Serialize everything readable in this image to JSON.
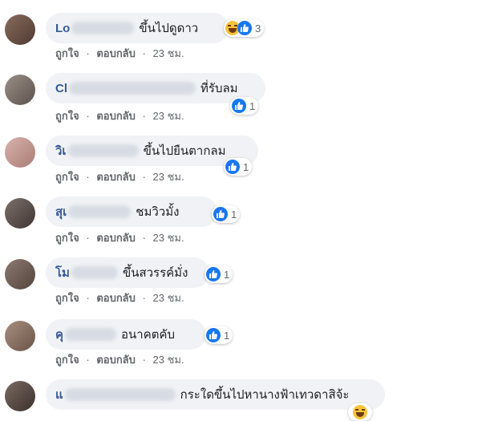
{
  "comments": [
    {
      "name": "Lo",
      "text": "ขึ้นไปดูดาว",
      "reactions": [
        "haha",
        "like"
      ],
      "count": "3",
      "like": "ถูกใจ",
      "reply": "ตอบกลับ",
      "time": "23 ชม."
    },
    {
      "name": "Cl",
      "text": "ที่รับลม",
      "reactions": [
        "like"
      ],
      "count": "1",
      "like": "ถูกใจ",
      "reply": "ตอบกลับ",
      "time": "23 ชม."
    },
    {
      "name": "วิเ",
      "text": "ขึ้นไปยืนตากลม",
      "reactions": [
        "like"
      ],
      "count": "1",
      "like": "ถูกใจ",
      "reply": "ตอบกลับ",
      "time": "23 ชม."
    },
    {
      "name": "สุเ",
      "text": "ชมวิวมั้ง",
      "reactions": [
        "like"
      ],
      "count": "1",
      "like": "ถูกใจ",
      "reply": "ตอบกลับ",
      "time": "23 ชม."
    },
    {
      "name": "โม",
      "text": "ขึ้นสวรรค์มั่ง",
      "reactions": [
        "like"
      ],
      "count": "1",
      "like": "ถูกใจ",
      "reply": "ตอบกลับ",
      "time": "23 ชม."
    },
    {
      "name": "คุ",
      "text": "อนาคตคับ",
      "reactions": [
        "like"
      ],
      "count": "1",
      "like": "ถูกใจ",
      "reply": "ตอบกลับ",
      "time": "23 ชม."
    },
    {
      "name": "แ",
      "text": "กระใดขึ้นไปหานางฟ้าเทวดาสิจ้ะ",
      "reactions": [],
      "count": "",
      "like": "",
      "reply": "",
      "time": ""
    }
  ],
  "separator": "·",
  "colors": {
    "link": "#385898",
    "bubble": "#f0f2f5",
    "like": "#1877f2",
    "meta": "#65676b"
  }
}
